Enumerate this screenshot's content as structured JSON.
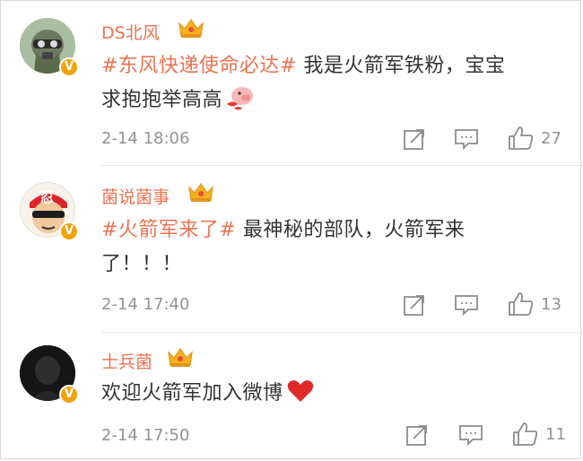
{
  "comments": [
    {
      "username": "DS北风",
      "verified_badge": "V",
      "hashtag": "#东风快递使命必达#",
      "text_line1": " 我是火箭军铁粉，宝宝",
      "text_line2": "求抱抱举高高",
      "time": "2-14 18:06",
      "likes": "27",
      "avatar_icon": "pilot-avatar-icon"
    },
    {
      "username": "菌说菌事",
      "verified_badge": "V",
      "hashtag": "#火箭军来了#",
      "text_line1": " 最神秘的部队，火箭军来",
      "text_line2": "了！！！",
      "time": "2-14 17:40",
      "likes": "13",
      "avatar_icon": "cartoon-avatar-icon",
      "avatar_text": "忍"
    },
    {
      "username": "士兵菌",
      "verified_badge": "V",
      "text_line1": "欢迎火箭军加入微博",
      "time": "2-14 17:50",
      "likes": "11",
      "avatar_icon": "soldier-avatar-icon"
    }
  ],
  "colors": {
    "username": "#eb7350",
    "hashtag": "#eb7350",
    "meta": "#939393",
    "badge": "#f2a20d",
    "heart": "#e02a2a"
  },
  "icons": [
    "crown-icon",
    "verified-badge-icon",
    "share-icon",
    "comment-icon",
    "like-icon",
    "pig-emoji-icon",
    "heart-icon"
  ]
}
